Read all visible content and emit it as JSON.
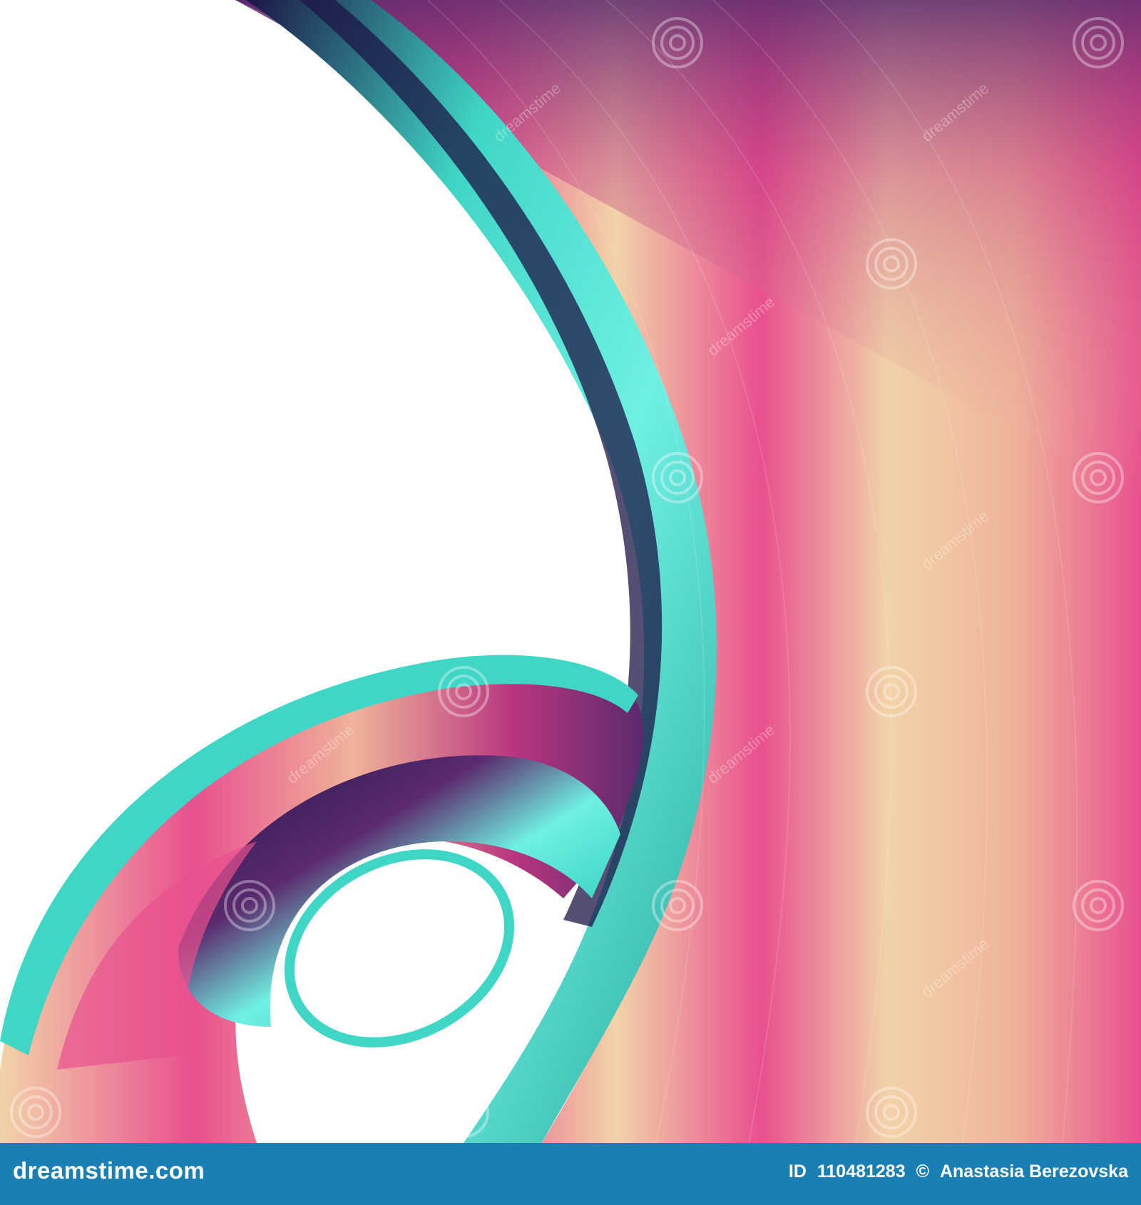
{
  "image": {
    "background_color": "#ffffff",
    "palette": {
      "teal": "#3fd6c6",
      "teal_light": "#6ff0e2",
      "pink": "#e8508f",
      "magenta": "#b8357f",
      "purple": "#5b2a6e",
      "navy": "#1c1445",
      "cream": "#f2d3a8",
      "peach": "#f0b39a"
    },
    "watermark_text": "dreamstime"
  },
  "footer": {
    "background_color": "#1a7fb3",
    "brand": "dreamstime.com",
    "id_label": "ID",
    "id_value": "110481283",
    "copyright_symbol": "©",
    "author": "Anastasia Berezovska"
  }
}
